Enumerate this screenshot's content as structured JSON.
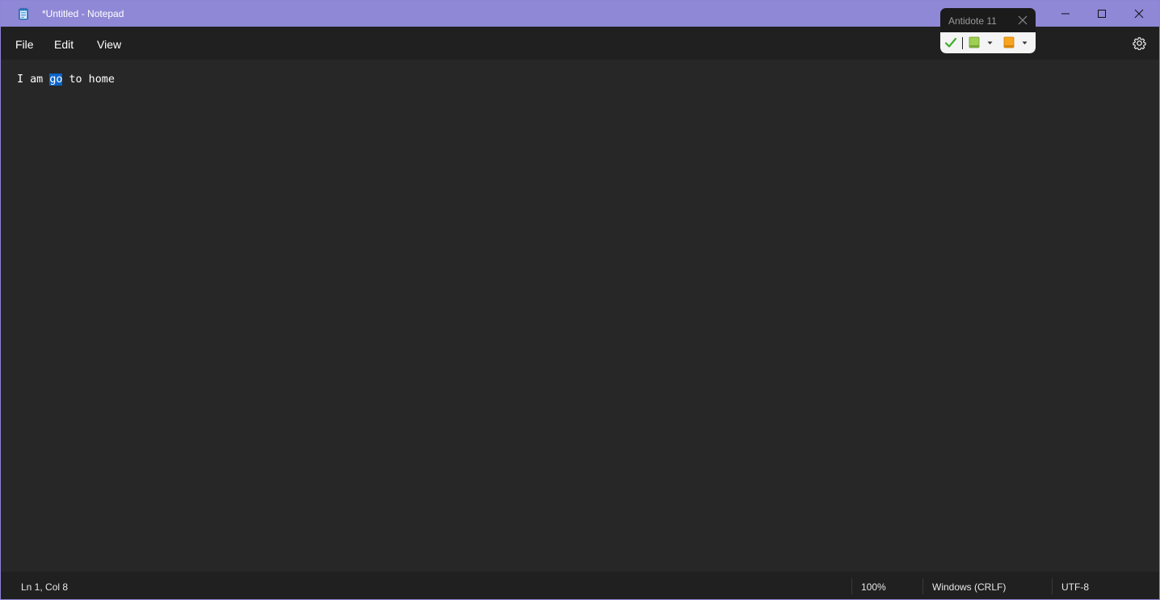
{
  "window": {
    "title": "*Untitled - Notepad"
  },
  "icons": {
    "app": "notepad-icon",
    "minimize": "minimize-icon",
    "maximize": "maximize-icon",
    "close": "close-icon",
    "settings": "gear-icon",
    "antidote_check": "checkmark-icon",
    "antidote_dictionary": "green-book-icon",
    "antidote_guide": "orange-book-icon"
  },
  "menu": {
    "file": "File",
    "edit": "Edit",
    "view": "View"
  },
  "editor": {
    "text_before": "I am ",
    "selected": "go",
    "text_after": " to home"
  },
  "status": {
    "position": "Ln 1, Col 8",
    "zoom": "100%",
    "line_endings": "Windows (CRLF)",
    "encoding": "UTF-8"
  },
  "antidote": {
    "title": "Antidote 11"
  },
  "colors": {
    "titlebar": "#8f88d6",
    "selection": "#0a63c9",
    "editor_bg": "#272727",
    "check_green": "#3fae29"
  }
}
